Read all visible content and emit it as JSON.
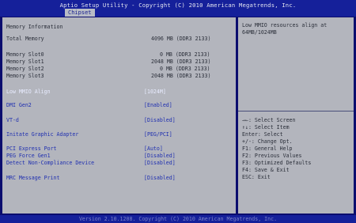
{
  "app": {
    "title": "Aptio Setup Utility - Copyright (C) 2010 American Megatrends, Inc.",
    "tab": "Chipset"
  },
  "main": {
    "section_title": "Memory Information",
    "total_memory": {
      "label": "Total Memory",
      "value": "4096 MB (DDR3 2133)"
    },
    "slots": [
      {
        "label": "Memory Slot0",
        "value": "0 MB (DDR3 2133)"
      },
      {
        "label": "Memory Slot1",
        "value": "2048 MB (DDR3 2133)"
      },
      {
        "label": "Memory Slot2",
        "value": "0 MB (DDR3 2133)"
      },
      {
        "label": "Memory Slot3",
        "value": "2048 MB (DDR3 2133)"
      }
    ],
    "options": [
      {
        "label": "Low MMIO Align",
        "value": "[1024M]"
      },
      {
        "label": "DMI Gen2",
        "value": "[Enabled]"
      },
      {
        "label": "VT-d",
        "value": "[Disabled]"
      },
      {
        "label": "Initate Graphic Adapter",
        "value": "[PEG/PCI]"
      },
      {
        "label": "PCI Express Port",
        "value": "[Auto]"
      },
      {
        "label": "PEG Force Gen1",
        "value": "[Disabled]"
      },
      {
        "label": "Detect Non-Compliance Device",
        "value": "[Disabled]"
      },
      {
        "label": "MRC Message Print",
        "value": "[Disabled]"
      }
    ]
  },
  "help": {
    "lines": [
      "Low MMIO resources align at",
      "64MB/1024MB"
    ],
    "keys": [
      "→←: Select Screen",
      "↑↓: Select Item",
      "Enter: Select",
      "+/-: Change Opt.",
      "F1: General Help",
      "F2: Previous Values",
      "F3: Optimized Defaults",
      "F4: Save & Exit",
      "ESC: Exit"
    ]
  },
  "footer": {
    "text": "Version 2.10.1208. Copyright (C) 2010 American Megatrends, Inc."
  },
  "colors": {
    "background": "#0b0d6e",
    "panel": "#b3b5bd",
    "option_blue": "#1f2fb0",
    "selected_text": "#e8ecff"
  }
}
